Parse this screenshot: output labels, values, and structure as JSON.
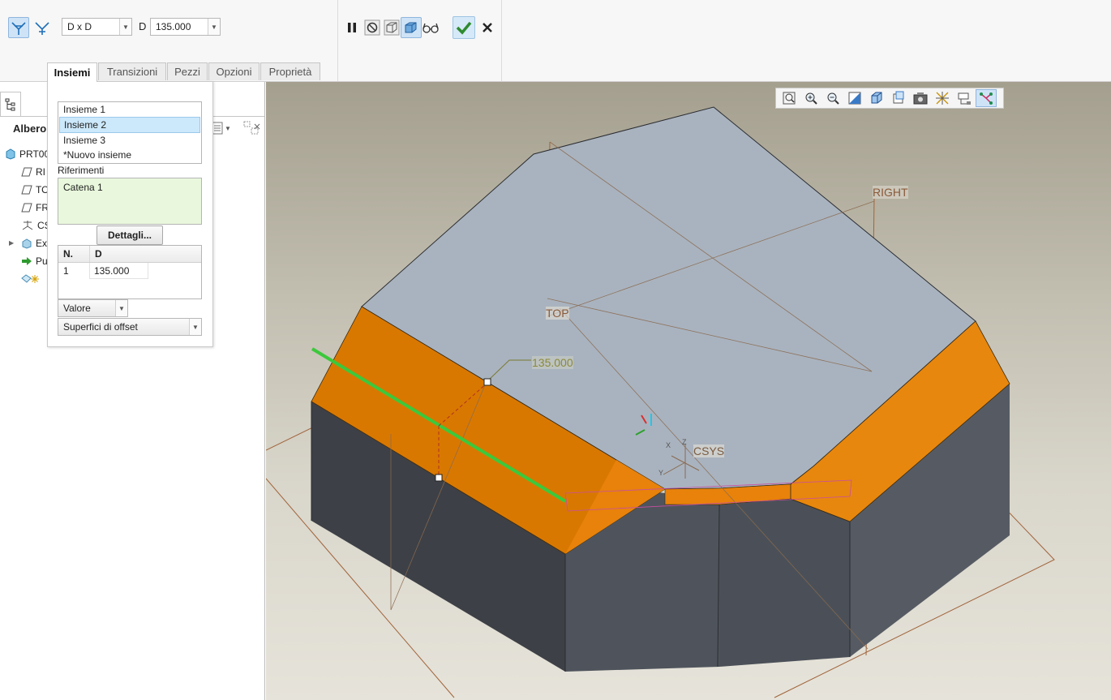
{
  "ribbon": {
    "type_value": "D x D",
    "dim_label": "D",
    "dim_value": "135.000",
    "icons": [
      "chamfer-edge-icon",
      "chamfer-corner-icon",
      "pause-icon",
      "no-preview-icon",
      "wireframe-preview-icon",
      "verify-preview-icon",
      "glasses-icon",
      "confirm-check-icon",
      "cancel-x-icon"
    ]
  },
  "tabs": [
    "Insiemi",
    "Transizioni",
    "Pezzi",
    "Opzioni",
    "Proprietà"
  ],
  "tree": {
    "header": "Albero",
    "items": [
      "PRT00",
      "RI",
      "TO",
      "FR",
      "CS",
      "Ex",
      "Pu",
      ""
    ]
  },
  "sets_panel": {
    "sets": [
      "Insieme 1",
      "Insieme 2",
      "Insieme 3",
      "*Nuovo insieme"
    ],
    "selected_index": 1,
    "references_label": "Riferimenti",
    "references": [
      "Catena 1"
    ],
    "details_button": "Dettagli...",
    "table_headers": [
      "N.",
      "D"
    ],
    "table_rows": [
      [
        "1",
        "135.000"
      ]
    ],
    "value_mode": "Valore",
    "offset_mode": "Superfici di offset"
  },
  "viewport": {
    "labels": {
      "right": "RIGHT",
      "top": "TOP",
      "csys": "CSYS",
      "dimension": "135.000",
      "axis_z": "Z",
      "axis_x": "X",
      "axis_y": "Y"
    },
    "colors": {
      "top_face": "#a9b3bf",
      "chamfer_face": "#e8820a",
      "side_face": "#4a4f56",
      "datum_plane": "#a0643a",
      "dimension_text": "#8a8a3a",
      "edge_highlight": "#3cc83c"
    }
  },
  "view_toolbar": {
    "icons": [
      "refit-icon",
      "zoom-in-icon",
      "zoom-out-icon",
      "repaint-icon",
      "display-style-icon",
      "saved-views-icon",
      "view-manager-icon",
      "datum-display-icon",
      "annotation-display-icon",
      "spin-center-icon"
    ]
  }
}
